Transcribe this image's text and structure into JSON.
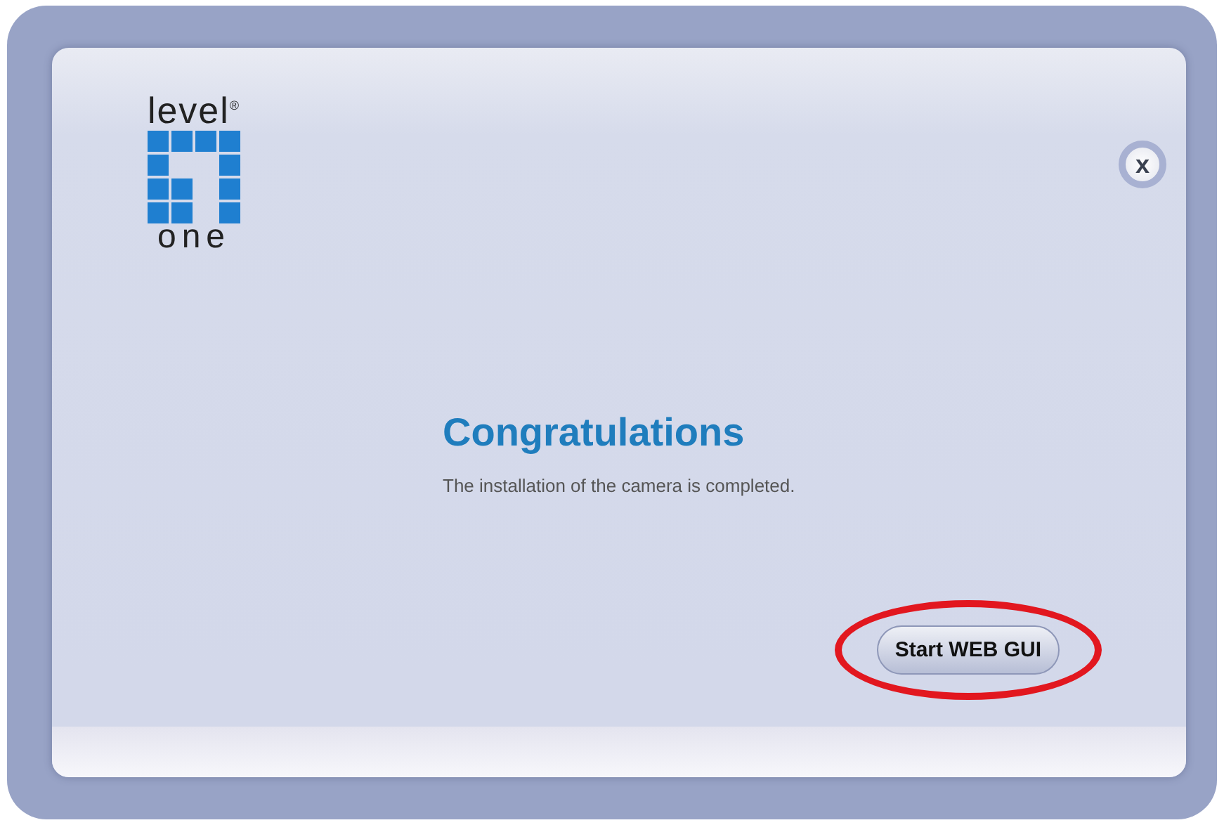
{
  "logo": {
    "top": "level$^{®}$",
    "bottom": "one"
  },
  "dialog": {
    "title": "Congratulations",
    "message": "The installation of the camera is completed."
  },
  "close_button": {
    "label": "x"
  },
  "action_button": {
    "label": "Start WEB GUI",
    "highlighted": true
  }
}
